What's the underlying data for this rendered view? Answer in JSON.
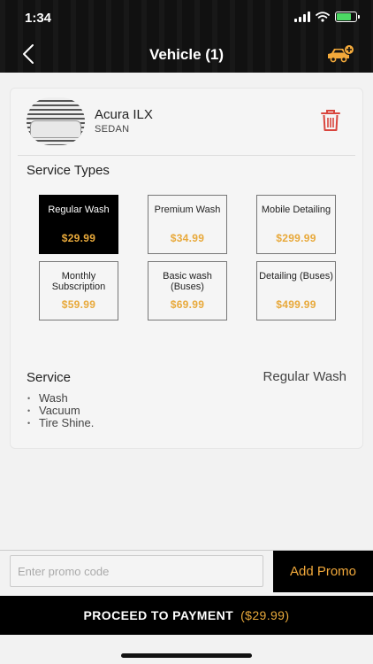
{
  "status_bar": {
    "time": "1:34",
    "battery_level": 0.75,
    "battery_color": "#4cd964"
  },
  "header": {
    "title": "Vehicle (1)",
    "back_icon": "chevron-left-icon",
    "action_icon": "car-add-icon",
    "action_color": "#f2a93b"
  },
  "vehicle": {
    "name": "Acura ILX",
    "type": "SEDAN",
    "delete_icon": "trash-icon",
    "delete_color": "#d9453d"
  },
  "service_types": {
    "title": "Service Types",
    "selected_index": 0,
    "items": [
      {
        "name": "Regular Wash",
        "price": "$29.99"
      },
      {
        "name": "Premium Wash",
        "price": "$34.99"
      },
      {
        "name": "Mobile Detailing",
        "price": "$299.99"
      },
      {
        "name": "Monthly Subscription",
        "price": "$59.99"
      },
      {
        "name": "Basic wash (Buses)",
        "price": "$69.99"
      },
      {
        "name": "Detailing (Buses)",
        "price": "$499.99"
      }
    ]
  },
  "service": {
    "label": "Service",
    "value": "Regular Wash",
    "features": [
      "Wash",
      "Vacuum",
      "Tire Shine."
    ]
  },
  "promo": {
    "placeholder": "Enter promo code",
    "button_label": "Add Promo"
  },
  "checkout": {
    "label": "PROCEED TO PAYMENT",
    "price": "($29.99)"
  },
  "colors": {
    "accent": "#e8a93b",
    "header_bg": "#111111",
    "selected_tile": "#000000"
  }
}
